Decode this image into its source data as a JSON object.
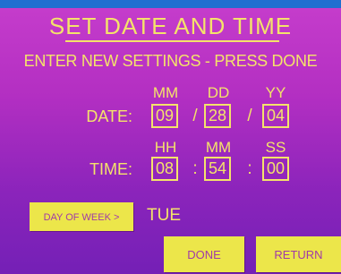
{
  "screen": {
    "title": "SET DATE AND TIME",
    "instruction": "ENTER NEW SETTINGS - PRESS DONE"
  },
  "date": {
    "label": "DATE:",
    "headers": [
      "MM",
      "DD",
      "YY"
    ],
    "values": [
      "09",
      "28",
      "04"
    ],
    "separator": "/"
  },
  "time": {
    "label": "TIME:",
    "headers": [
      "HH",
      "MM",
      "SS"
    ],
    "values": [
      "08",
      "54",
      "00"
    ],
    "separator": ":"
  },
  "day_of_week": {
    "button_label": "DAY OF WEEK >",
    "value": "TUE"
  },
  "buttons": {
    "done_label": "DONE",
    "return_label": "RETURN"
  },
  "colors": {
    "text": "#f4e36a",
    "button": "#ece64a",
    "button_text": "#a03aa8",
    "background_top": "#c63dcc",
    "background_bottom": "#7420b6",
    "top_bar": "#1f6fd0"
  }
}
